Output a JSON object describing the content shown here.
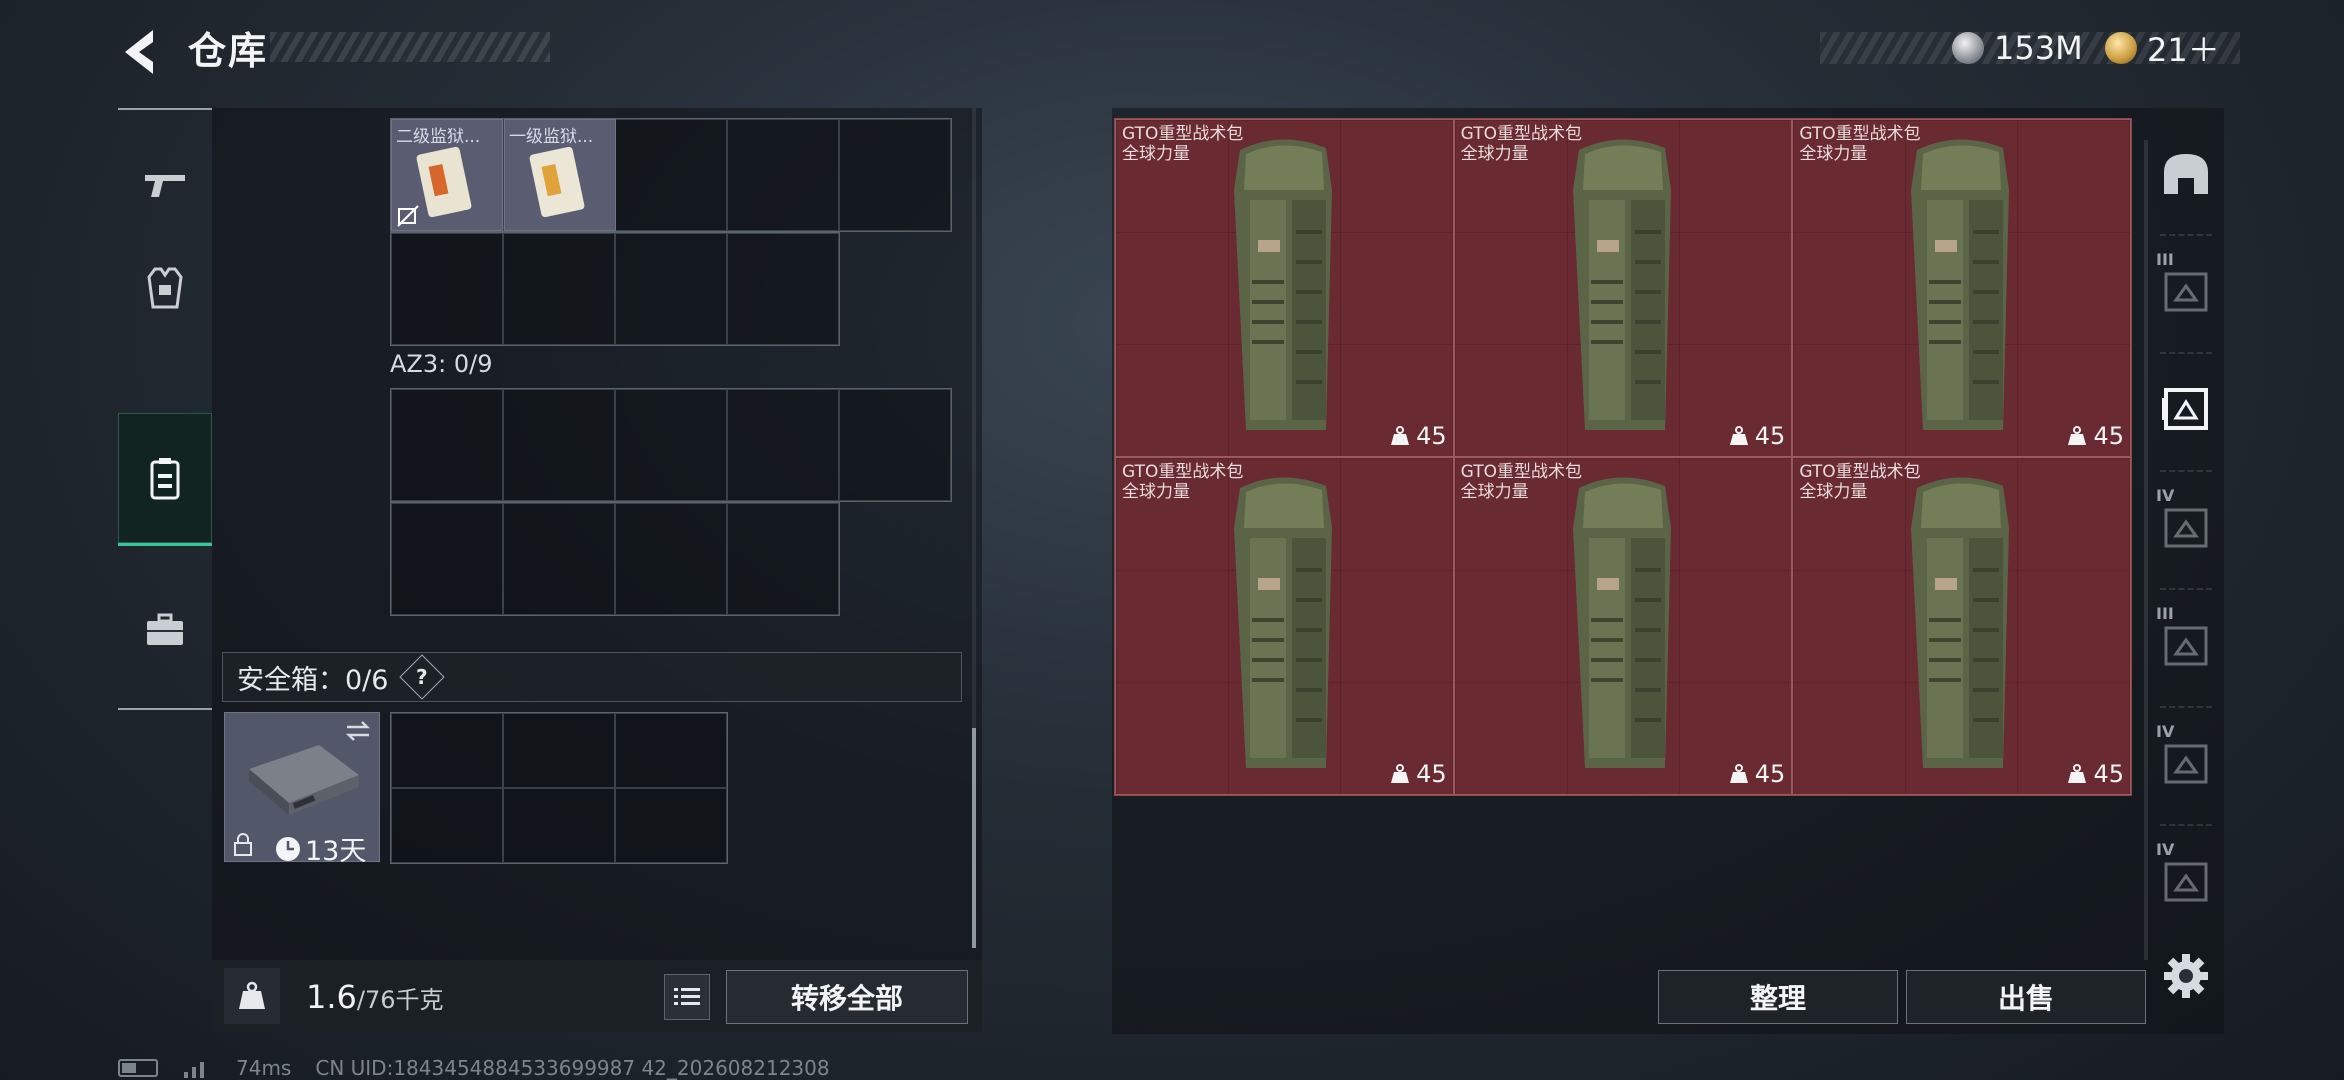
{
  "header": {
    "title": "仓库",
    "currency": [
      {
        "icon": "silver-coin-icon",
        "value": "153M"
      },
      {
        "icon": "gold-rank-icon",
        "value": "21＋"
      }
    ]
  },
  "left_nav": [
    "weapon-icon",
    "armor-icon",
    "backpack-icon",
    "briefcase-icon"
  ],
  "left_panel": {
    "top_items": [
      {
        "label": "二级监狱..."
      },
      {
        "label": "一级监狱..."
      }
    ],
    "az3_label": "AZ3: 0/9",
    "safe_label": "安全箱：0/6",
    "safe_help": "?",
    "safe_timer": "13天"
  },
  "bottom": {
    "weight_value": "1.6",
    "weight_max": "/76千克",
    "transfer_all": "转移全部"
  },
  "right_panel": {
    "items": [
      {
        "name": "GTO重型战术包",
        "sub": "全球力量",
        "qty": "45"
      },
      {
        "name": "GTO重型战术包",
        "sub": "全球力量",
        "qty": "45"
      },
      {
        "name": "GTO重型战术包",
        "sub": "全球力量",
        "qty": "45"
      },
      {
        "name": "GTO重型战术包",
        "sub": "全球力量",
        "qty": "45"
      },
      {
        "name": "GTO重型战术包",
        "sub": "全球力量",
        "qty": "45"
      },
      {
        "name": "GTO重型战术包",
        "sub": "全球力量",
        "qty": "45"
      }
    ],
    "sort": "整理",
    "sell": "出售"
  },
  "right_nav": [
    {
      "icon": "helmet-icon",
      "tier": ""
    },
    {
      "icon": "vest-tier3-icon",
      "tier": "III"
    },
    {
      "icon": "vest-tier3-active-icon",
      "tier": ""
    },
    {
      "icon": "backpack-tier4-icon",
      "tier": "IV"
    },
    {
      "icon": "vest-tier3-b-icon",
      "tier": "III"
    },
    {
      "icon": "rig-tier4-icon",
      "tier": "IV"
    },
    {
      "icon": "rig-tier4-b-icon",
      "tier": "IV"
    }
  ],
  "footer": {
    "ping": "74ms",
    "uid": "CN UID:1843454884533699987 42_202608212308"
  },
  "colors": {
    "accent_green": "#37c79b",
    "item_red": "#6a2a31"
  }
}
